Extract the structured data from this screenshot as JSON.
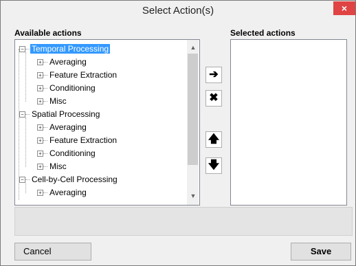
{
  "window": {
    "title": "Select Action(s)",
    "close_glyph": "×"
  },
  "labels": {
    "available": "Available actions",
    "selected": "Selected actions"
  },
  "tree": {
    "items": [
      {
        "label": "Temporal Processing",
        "level": 0,
        "expanded": true,
        "selected": true
      },
      {
        "label": "Averaging",
        "level": 1
      },
      {
        "label": "Feature Extraction",
        "level": 1
      },
      {
        "label": "Conditioning",
        "level": 1
      },
      {
        "label": "Misc",
        "level": 1
      },
      {
        "label": "Spatial Processing",
        "level": 0,
        "expanded": true
      },
      {
        "label": "Averaging",
        "level": 1
      },
      {
        "label": "Feature Extraction",
        "level": 1
      },
      {
        "label": "Conditioning",
        "level": 1
      },
      {
        "label": "Misc",
        "level": 1
      },
      {
        "label": "Cell-by-Cell Processing",
        "level": 0,
        "expanded": true
      },
      {
        "label": "Averaging",
        "level": 1
      }
    ]
  },
  "icons": {
    "add": "arrow-right-icon",
    "remove": "x-icon",
    "up": "arrow-up-icon",
    "down": "arrow-down-icon"
  },
  "glyphs": {
    "add": "➔",
    "remove": "✖",
    "up": "🡅",
    "down": "🡇",
    "scroll_up": "▲",
    "scroll_down": "▼"
  },
  "buttons": {
    "cancel": "Cancel",
    "save": "Save"
  }
}
